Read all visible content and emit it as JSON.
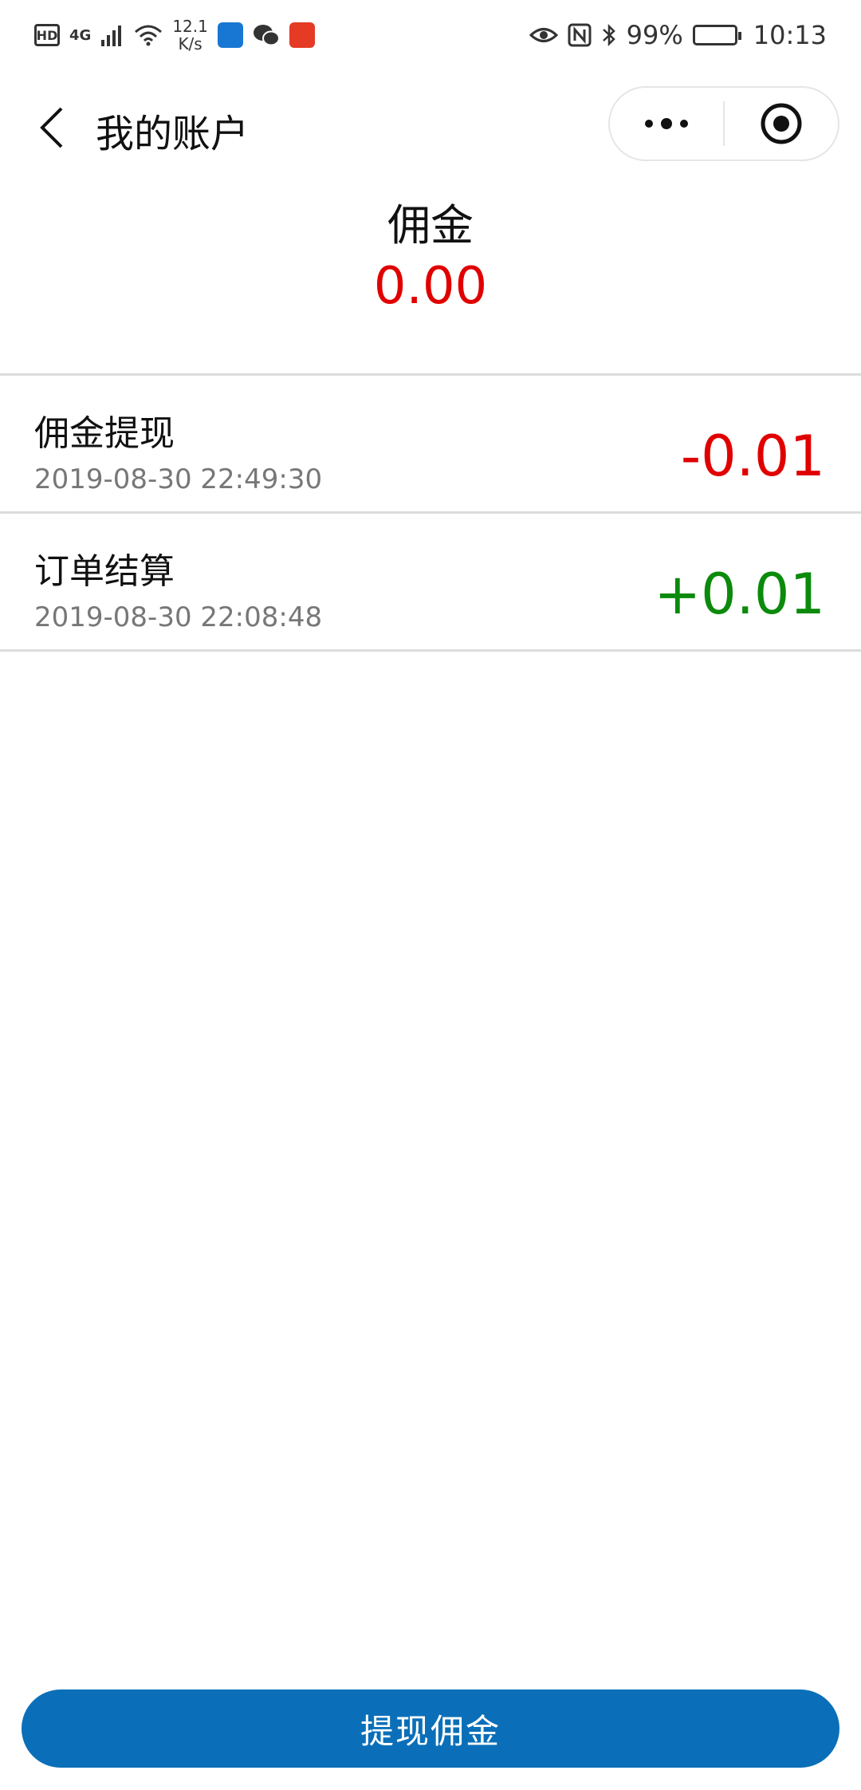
{
  "status_bar": {
    "hd": "HD",
    "network": "4G",
    "net_speed_value": "12.1",
    "net_speed_unit": "K/s",
    "battery": "99%",
    "time": "10:13",
    "icons": [
      "hd-icon",
      "signal-icon",
      "wifi-icon",
      "shield-app-icon",
      "wechat-icon",
      "app-icon",
      "eye-icon",
      "nfc-icon",
      "bluetooth-icon",
      "battery-icon"
    ]
  },
  "nav": {
    "title": "我的账户",
    "back_icon": "chevron-left-icon",
    "more_icon": "more-dots-icon",
    "close_icon": "target-circle-icon"
  },
  "balance": {
    "label": "佣金",
    "value": "0.00"
  },
  "records": [
    {
      "title": "佣金提现",
      "time": "2019-08-30 22:49:30",
      "amount": "-0.01",
      "color": "#e00000"
    },
    {
      "title": "订单结算",
      "time": "2019-08-30 22:08:48",
      "amount": "+0.01",
      "color": "#0b8a0b"
    }
  ],
  "button": {
    "label": "提现佣金",
    "color": "#0a6fb8"
  }
}
